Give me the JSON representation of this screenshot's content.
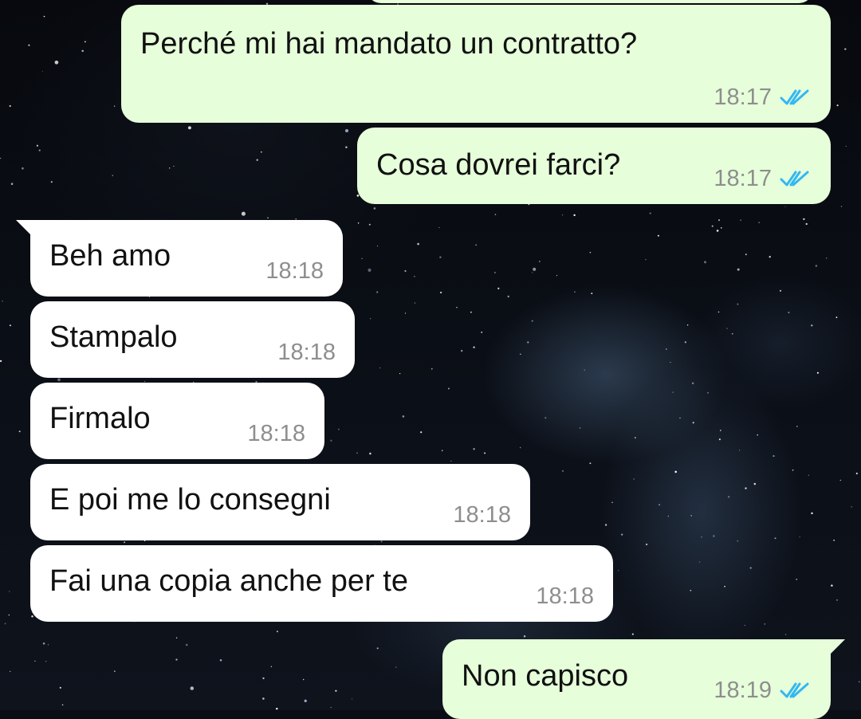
{
  "messages": [
    {
      "id": "m1",
      "direction": "out",
      "text": "Perché mi hai mandato un contratto?",
      "time": "18:17",
      "status": "read"
    },
    {
      "id": "m2",
      "direction": "out",
      "text": "Cosa dovrei farci?",
      "time": "18:17",
      "status": "read"
    },
    {
      "id": "m3",
      "direction": "in",
      "text": "Beh amo",
      "time": "18:18"
    },
    {
      "id": "m4",
      "direction": "in",
      "text": "Stampalo",
      "time": "18:18"
    },
    {
      "id": "m5",
      "direction": "in",
      "text": "Firmalo",
      "time": "18:18"
    },
    {
      "id": "m6",
      "direction": "in",
      "text": "E poi me lo consegni",
      "time": "18:18"
    },
    {
      "id": "m7",
      "direction": "in",
      "text": "Fai una copia anche per te",
      "time": "18:18"
    },
    {
      "id": "m8",
      "direction": "out",
      "text": "Non capisco",
      "time": "18:19",
      "status": "read"
    }
  ],
  "colors": {
    "outgoing_bubble": "#e6ffda",
    "incoming_bubble": "#ffffff",
    "read_ticks": "#34b7f1",
    "timestamp": "#8e8e8e",
    "wallpaper": "#0a0d14"
  },
  "icons": {
    "read_receipt": "double-check-icon"
  }
}
